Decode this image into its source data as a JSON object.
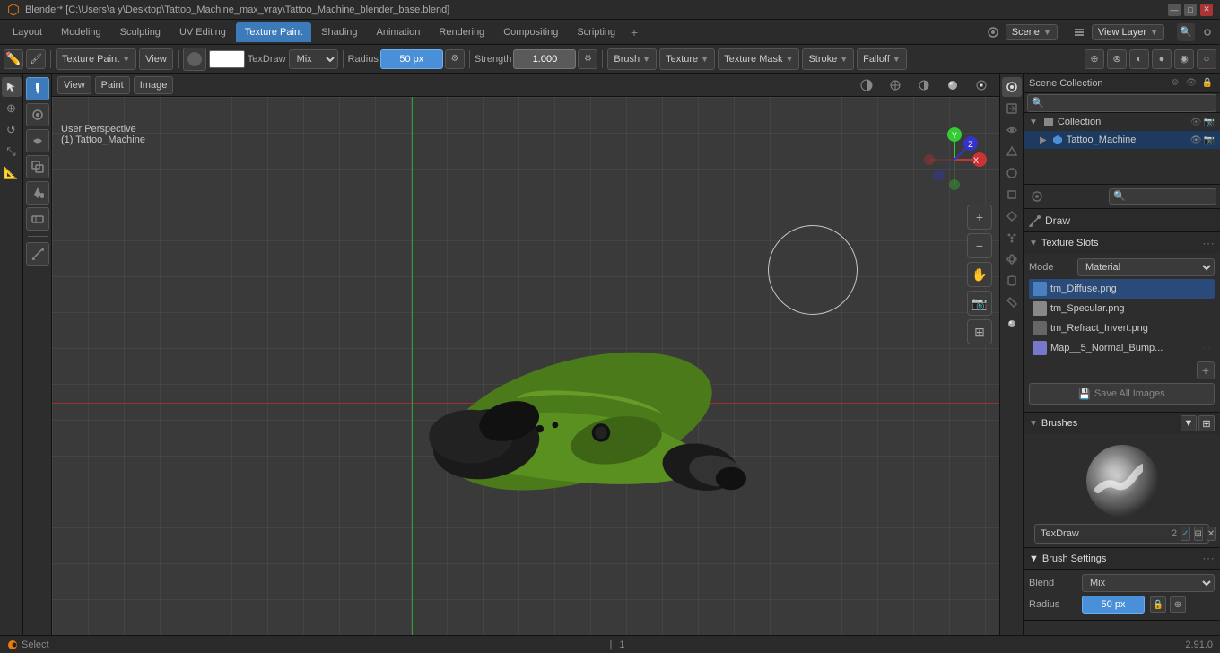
{
  "titlebar": {
    "title": "Blender* [C:\\Users\\a y\\Desktop\\Tattoo_Machine_max_vray\\Tattoo_Machine_blender_base.blend]",
    "min_btn": "—",
    "max_btn": "□",
    "close_btn": "✕"
  },
  "tabs": {
    "items": [
      {
        "label": "Layout",
        "active": false
      },
      {
        "label": "Modeling",
        "active": false
      },
      {
        "label": "Sculpting",
        "active": false
      },
      {
        "label": "UV Editing",
        "active": false
      },
      {
        "label": "Texture Paint",
        "active": true
      },
      {
        "label": "Shading",
        "active": false
      },
      {
        "label": "Animation",
        "active": false
      },
      {
        "label": "Rendering",
        "active": false
      },
      {
        "label": "Compositing",
        "active": false
      },
      {
        "label": "Scripting",
        "active": false
      }
    ],
    "add_label": "+",
    "scene_label": "Scene",
    "scene_value": "Scene",
    "viewlayer_label": "View Layer",
    "viewlayer_value": "View Layer"
  },
  "toolbar": {
    "mode_label": "Texture Paint",
    "view_label": "View",
    "brush_name": "TexDraw",
    "radius_label": "Radius",
    "radius_value": "50 px",
    "strength_label": "Strength",
    "strength_value": "1.000",
    "brush_label": "Brush",
    "texture_label": "Texture",
    "texture_mask_label": "Texture Mask",
    "stroke_label": "Stroke",
    "falloff_label": "Falloff"
  },
  "viewport": {
    "perspective_label": "User Perspective",
    "object_label": "(1) Tattoo_Machine"
  },
  "outliner": {
    "header": "Scene Collection",
    "items": [
      {
        "label": "Collection",
        "indent": 1,
        "expanded": true
      },
      {
        "label": "Tattoo_Machine",
        "indent": 2,
        "selected": true
      }
    ]
  },
  "right_panel": {
    "search_placeholder": "🔍",
    "texture_slots": {
      "header": "Texture Slots",
      "mode_label": "Mode",
      "mode_value": "Material",
      "items": [
        {
          "name": "tm_Diffuse.png",
          "color": "#4a7fc0",
          "selected": true
        },
        {
          "name": "tm_Specular.png",
          "color": "#888888"
        },
        {
          "name": "tm_Refract_Invert.png",
          "color": "#666666"
        },
        {
          "name": "Map__5_Normal_Bump...",
          "color": "#7777cc"
        }
      ],
      "save_images_btn": "Save All Images"
    },
    "brushes": {
      "header": "Brushes",
      "brush_name": "TexDraw",
      "brush_num": "2"
    },
    "brush_settings": {
      "header": "Brush Settings",
      "blend_label": "Blend",
      "blend_value": "Mix",
      "radius_label": "Radius",
      "radius_value": "50 px"
    }
  },
  "status_bar": {
    "select_label": "Select",
    "frame_num": "1",
    "version": "2.91.0"
  },
  "icons": {
    "arrow_right": "▶",
    "arrow_down": "▼",
    "eye": "👁",
    "camera": "📷",
    "lock": "🔒",
    "add": "+",
    "search": "🔍",
    "dot": "•"
  }
}
